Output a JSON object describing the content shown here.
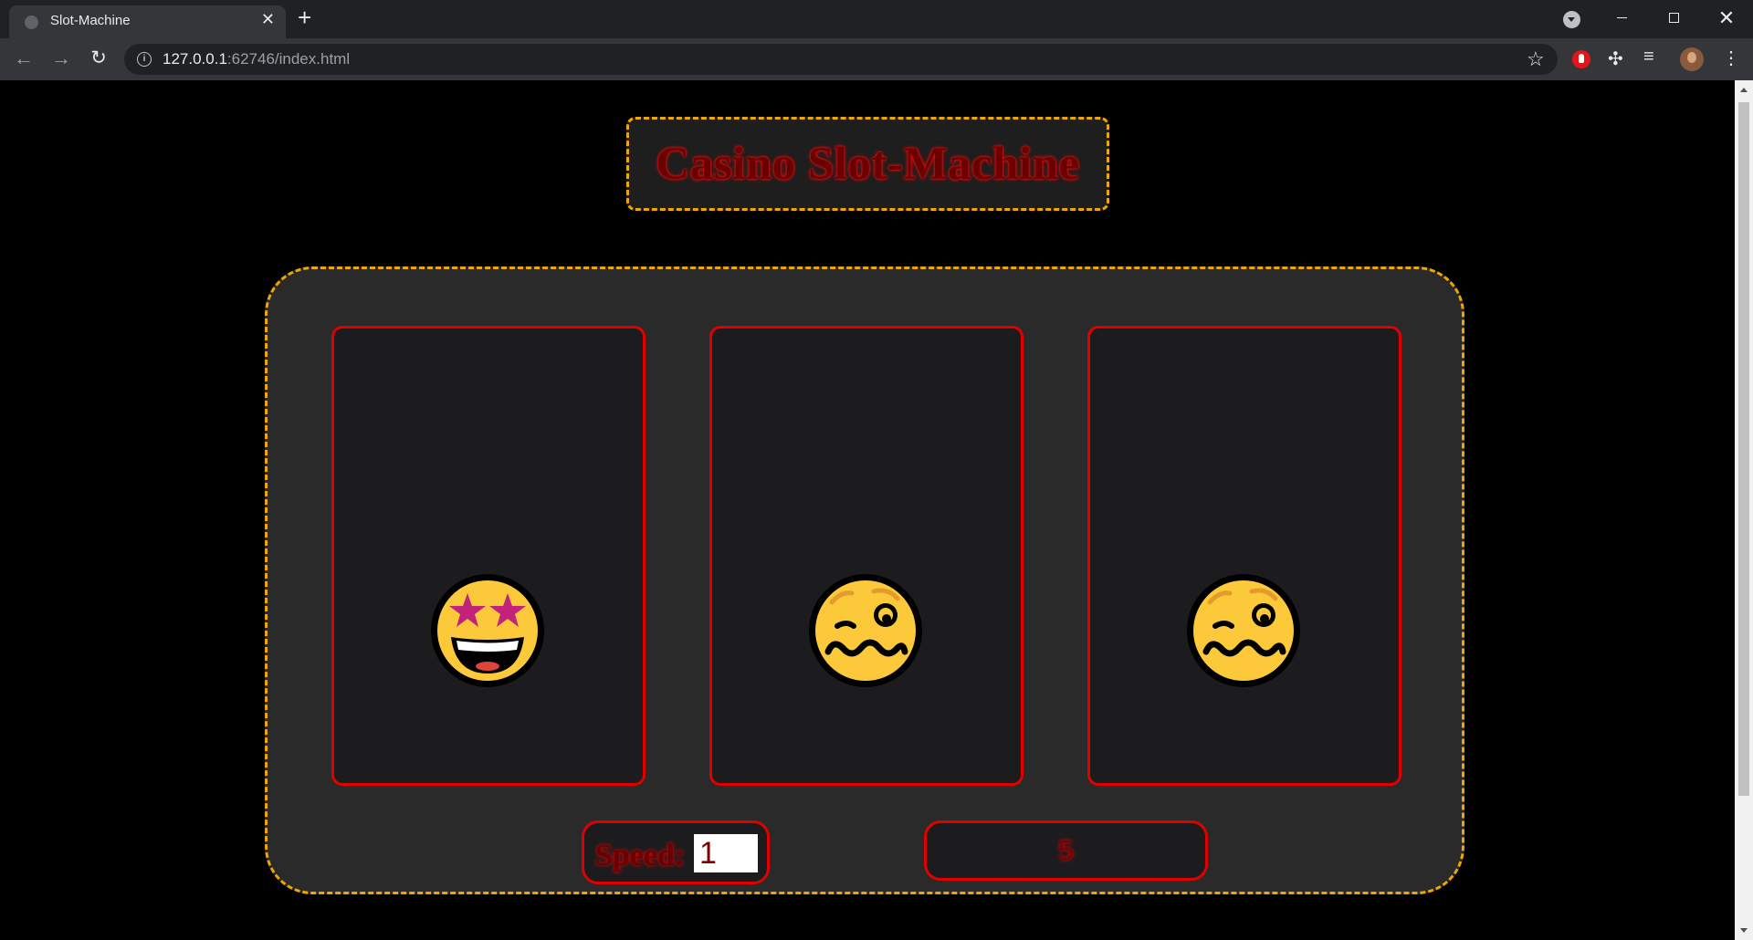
{
  "browser": {
    "tab_title": "Slot-Machine",
    "url_host": "127.0.0.1",
    "url_rest": ":62746/index.html"
  },
  "page": {
    "title": "Casino Slot-Machine",
    "speed_label": "Speed:",
    "speed_value": "1",
    "result": "5"
  },
  "reels": [
    {
      "emoji": "star-struck-face"
    },
    {
      "emoji": "woozy-face"
    },
    {
      "emoji": "woozy-face"
    }
  ],
  "colors": {
    "accent_dashed": "#f0a500",
    "reel_border": "#e00000",
    "title_text": "#6b0000"
  }
}
